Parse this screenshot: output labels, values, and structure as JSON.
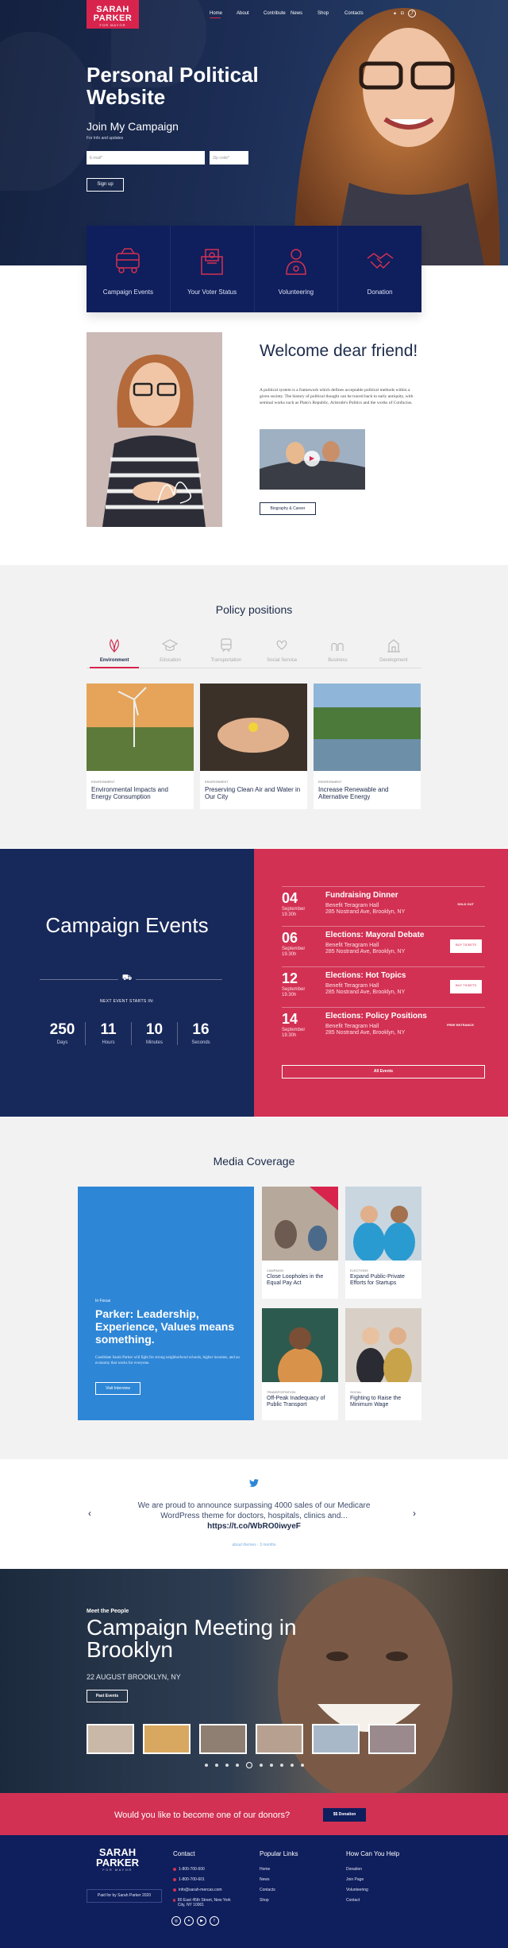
{
  "header": {
    "logo": {
      "line1": "SARAH",
      "line2": "PARKER",
      "tagline": "FOR MAYOR"
    },
    "nav": [
      "Home",
      "About",
      "Contribute",
      "News",
      "Shop",
      "Contacts"
    ],
    "social_icons": [
      "twitter-icon",
      "instagram-icon",
      "share-icon"
    ]
  },
  "hero": {
    "title": "Personal Political Website",
    "subtitle": "Join My Campaign",
    "info": "For Info and updates",
    "email_placeholder": "E-mail*",
    "zip_placeholder": "Zip code*",
    "signup_label": "Sign up"
  },
  "services": [
    {
      "label": "Campaign Events",
      "icon": "bus-icon"
    },
    {
      "label": "Your Voter Status",
      "icon": "ballot-box-icon"
    },
    {
      "label": "Volunteering",
      "icon": "volunteer-icon"
    },
    {
      "label": "Donation",
      "icon": "handshake-icon"
    }
  ],
  "welcome": {
    "title": "Welcome dear friend!",
    "text": "A political system is a framework which defines acceptable political methods within a given society. The history of political thought can be traced back to early antiquity, with seminal works such as Plato's Republic, Aristotle's Politics and the works of Confucius.",
    "bio_button": "Biography & Career"
  },
  "policy": {
    "title": "Policy positions",
    "tabs": [
      "Environment",
      "Education",
      "Transportation",
      "Social Service",
      "Business",
      "Development"
    ],
    "cards": [
      {
        "tag": "ENVIRONMENT",
        "title": "Environmental Impacts and Energy Consumption"
      },
      {
        "tag": "ENVIRONMENT",
        "title": "Preserving Clean Air and Water in Our City"
      },
      {
        "tag": "ENVIRONMENT",
        "title": "Increase Renewable and Alternative Energy"
      }
    ]
  },
  "events": {
    "title": "Campaign Events",
    "next_label": "NEXT EVENT STARTS IN:",
    "countdown": [
      {
        "value": "250",
        "unit": "Days"
      },
      {
        "value": "11",
        "unit": "Hours"
      },
      {
        "value": "10",
        "unit": "Minutes"
      },
      {
        "value": "16",
        "unit": "Seconds"
      }
    ],
    "list": [
      {
        "day": "04",
        "month": "September",
        "time": "19.30h",
        "title": "Fundraising Dinner",
        "venue": "Benefit Teragram Hall",
        "address": "285 Nostrand Ave, Brooklyn, NY",
        "status": "SOLD OUT",
        "button": ""
      },
      {
        "day": "06",
        "month": "September",
        "time": "19.30h",
        "title": "Elections: Mayoral Debate",
        "venue": "Benefit Teragram Hall",
        "address": "285 Nostrand Ave, Brooklyn, NY",
        "status": "",
        "button": "BUY TICKETS"
      },
      {
        "day": "12",
        "month": "September",
        "time": "19.30h",
        "title": "Elections: Hot Topics",
        "venue": "Benefit Teragram Hall",
        "address": "285 Nostrand Ave, Brooklyn, NY",
        "status": "",
        "button": "BUY TICKETS"
      },
      {
        "day": "14",
        "month": "September",
        "time": "19.30h",
        "title": "Elections: Policy Positions",
        "venue": "Benefit Teragram Hall",
        "address": "285 Nostrand Ave, Brooklyn, NY",
        "status": "FREE ENTRANCE",
        "button": ""
      }
    ],
    "all_button": "All Events"
  },
  "media": {
    "title": "Media Coverage",
    "featured": {
      "tag": "In Focus",
      "title": "Parker: Leadership, Experience, Values means something.",
      "text": "Candidate Sarah Parker will fight for strong neighborhood schools, higher incomes, and an economy that works for everyone.",
      "button": "Visit Interview"
    },
    "cards": [
      {
        "tag": "CAMPAIGN",
        "title": "Close Loopholes in the Equal Pay Act"
      },
      {
        "tag": "ELECTIONS",
        "title": "Expand Public-Private Efforts for Startups"
      },
      {
        "tag": "TRANSPORTATION",
        "title": "Off-Peak Inadequacy of Public Transport"
      },
      {
        "tag": "SOCIAL",
        "title": "Fighting to Raise the Minimum Wage"
      }
    ]
  },
  "tweet": {
    "text": "We are proud to announce surpassing 4000 sales of our Medicare WordPress theme for doctors, hospitals, clinics and...",
    "link": "https://t.co/WbRO0iwyeF",
    "meta": "about themes · 3 months"
  },
  "meeting": {
    "who": "Meet the People",
    "title": "Campaign Meeting in Brooklyn",
    "date": "22 AUGUST BROOKLYN, NY",
    "button": "Past Events"
  },
  "donor": {
    "question": "Would you like to become one of our donors?",
    "button": "$$ Donation"
  },
  "footer": {
    "logo": {
      "line1": "SARAH",
      "line2": "PARKER",
      "tagline": "FOR MAYOR"
    },
    "paid": "Paid for by Sarah Parker 2020",
    "contact_title": "Contact",
    "contact": [
      "1-800-700-600",
      "1-800-700-601",
      "info@sarah-mercas.com",
      "80 East 45th Street, New York City, NY 10001"
    ],
    "links_title": "Popular Links",
    "links": [
      "Home",
      "News",
      "Contacts",
      "Shop"
    ],
    "help_title": "How Can You Help",
    "help": [
      "Donation",
      "Join Page",
      "Volunteering",
      "Contact"
    ]
  },
  "colors": {
    "navy": "#0f1e5c",
    "red": "#d23153",
    "blue": "#2e86d6"
  }
}
